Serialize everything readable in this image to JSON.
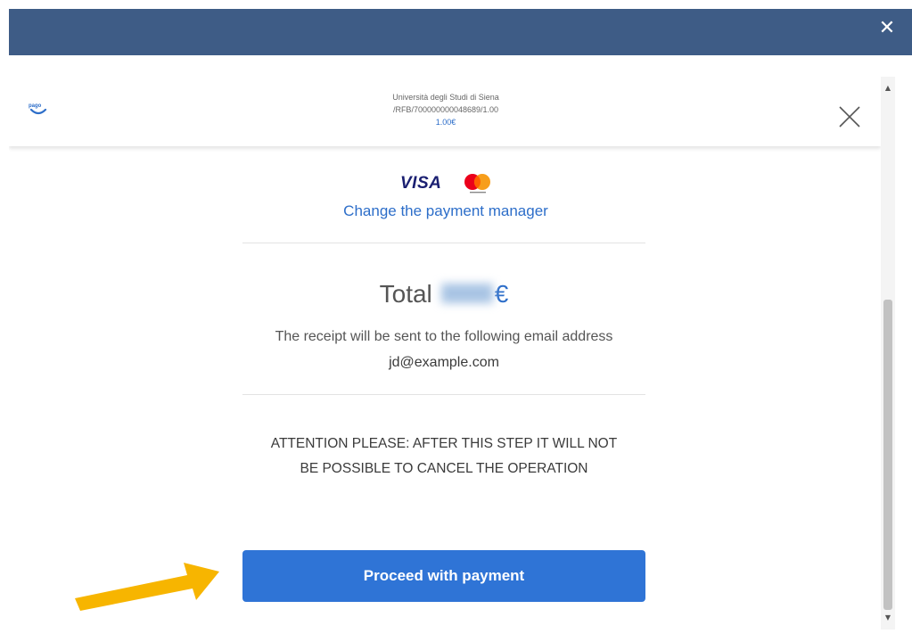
{
  "topbar": {
    "close_label": "✕"
  },
  "header": {
    "logo_icon": "pagopa-logo-icon",
    "merchant_name": "Università degli Studi di Siena",
    "reference": "/RFB/700000000048689/1.00",
    "amount": "1.00€",
    "close_icon": "close-icon"
  },
  "payment": {
    "card_brand": "VISA",
    "second_brand_icon": "mastercard-icon",
    "change_link": "Change the payment manager"
  },
  "summary": {
    "total_label": "Total",
    "total_currency": "€",
    "receipt_text": "The receipt will be sent to the following email address",
    "email": "jd@example.com"
  },
  "warning": {
    "line1": "ATTENTION PLEASE: AFTER THIS STEP IT WILL NOT",
    "line2": "BE POSSIBLE TO CANCEL THE OPERATION"
  },
  "actions": {
    "proceed_label": "Proceed with payment"
  },
  "colors": {
    "topbar": "#3e5c86",
    "accent": "#2f74d6",
    "link": "#2d6ec9",
    "annotation_arrow": "#f7b500"
  }
}
